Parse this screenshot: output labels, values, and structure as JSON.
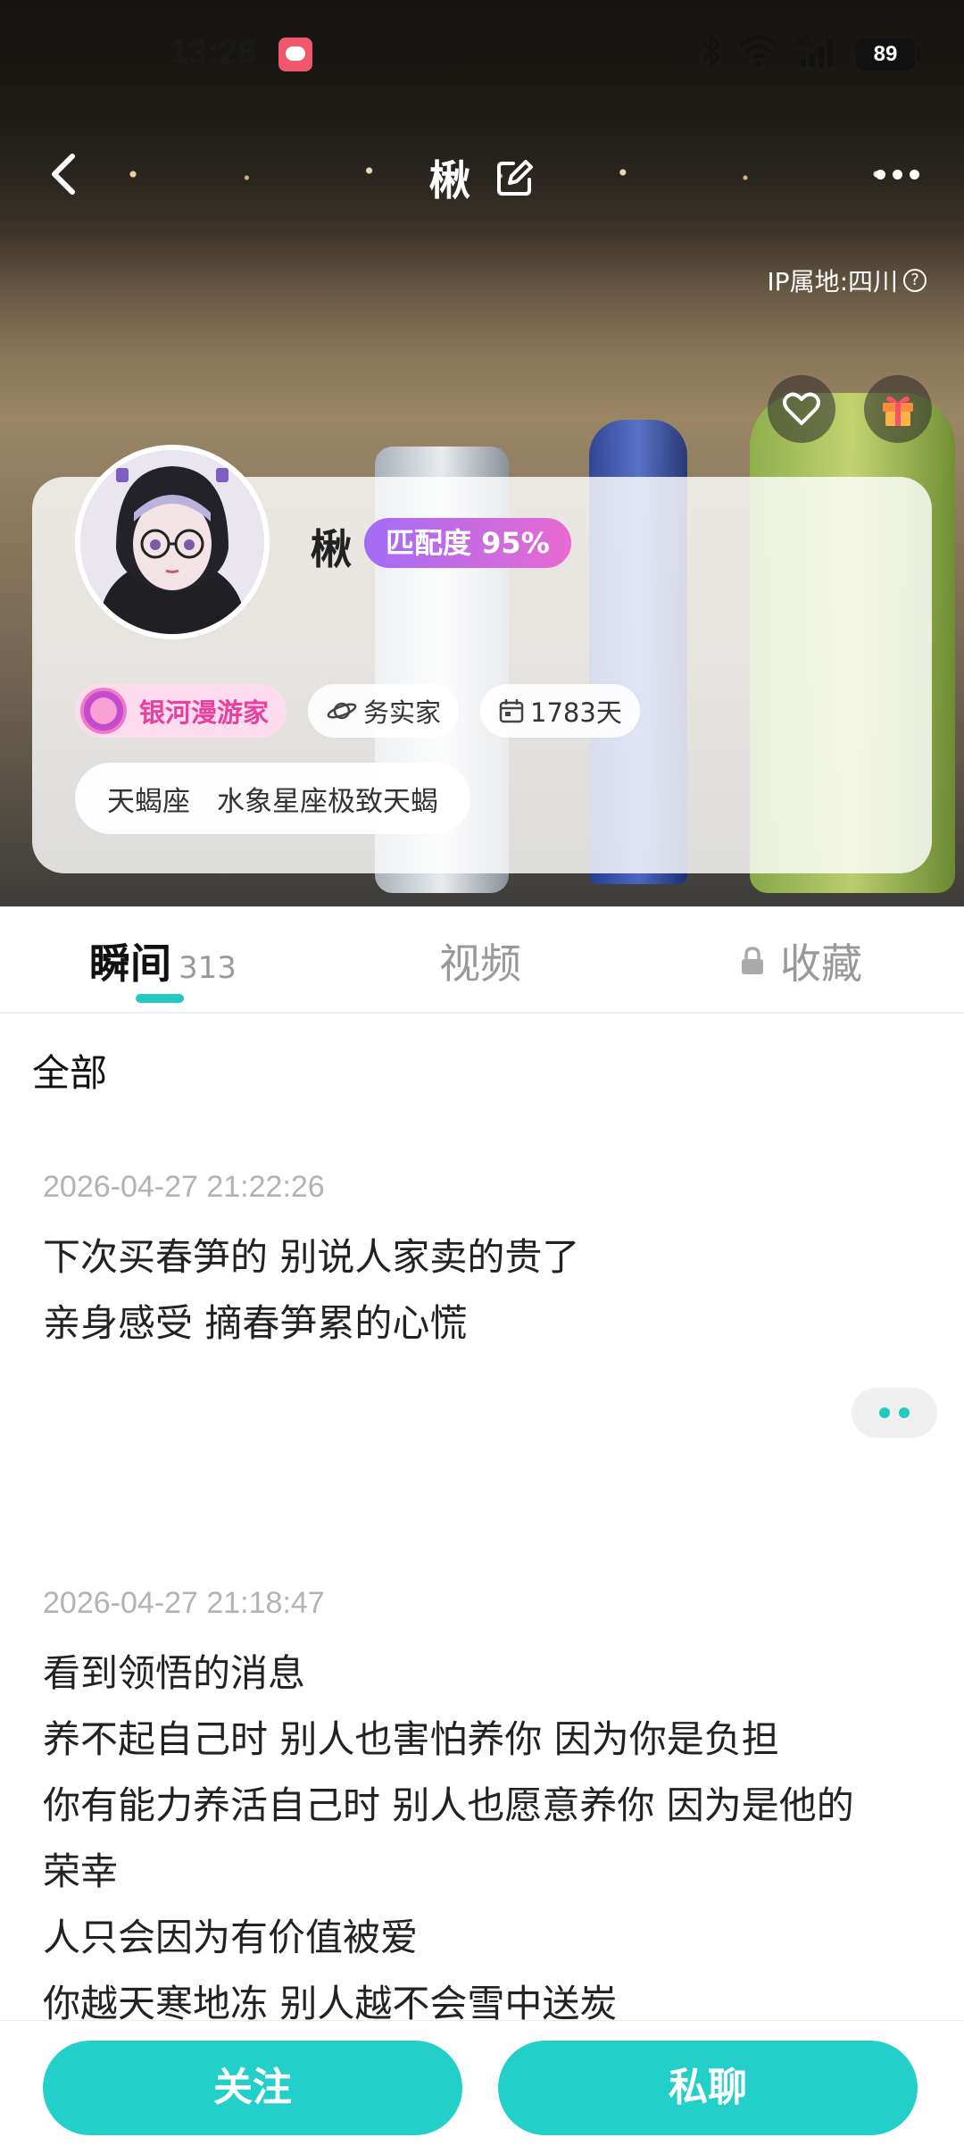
{
  "status_bar": {
    "time": "13:26",
    "battery": "89",
    "network": "5G"
  },
  "top_nav": {
    "title": "楸",
    "ip_location": "IP属地:四川"
  },
  "profile": {
    "name": "楸",
    "match_label": "匹配度",
    "match_value": "95%",
    "level_tag": "银河漫游家",
    "personality_tag": "务实家",
    "days_tag": "1783天",
    "zodiac_sign": "天蝎座",
    "zodiac_desc": "水象星座极致天蝎"
  },
  "tabs": {
    "moments_label": "瞬间",
    "moments_count": "313",
    "videos_label": "视频",
    "favorites_label": "收藏"
  },
  "feed": {
    "filter_label": "全部",
    "posts": [
      {
        "timestamp": "2026-04-27 21:22:26",
        "lines": [
          "下次买春笋的 别说人家卖的贵了",
          "亲身感受 摘春笋累的心慌"
        ]
      },
      {
        "timestamp": "2026-04-27 21:18:47",
        "lines": [
          "看到领悟的消息",
          "养不起自己时 别人也害怕养你 因为你是负担",
          "你有能力养活自己时 别人也愿意养你 因为是他的",
          "荣幸",
          "人只会因为有价值被爱",
          "你越天寒地冻 别人越不会雪中送炭"
        ]
      }
    ]
  },
  "actions": {
    "follow_label": "关注",
    "chat_label": "私聊"
  },
  "colors": {
    "accent": "#23cfc9",
    "match_gradient_start": "#a36cf5",
    "match_gradient_end": "#e86ad0",
    "level_pink": "#e8409e"
  }
}
